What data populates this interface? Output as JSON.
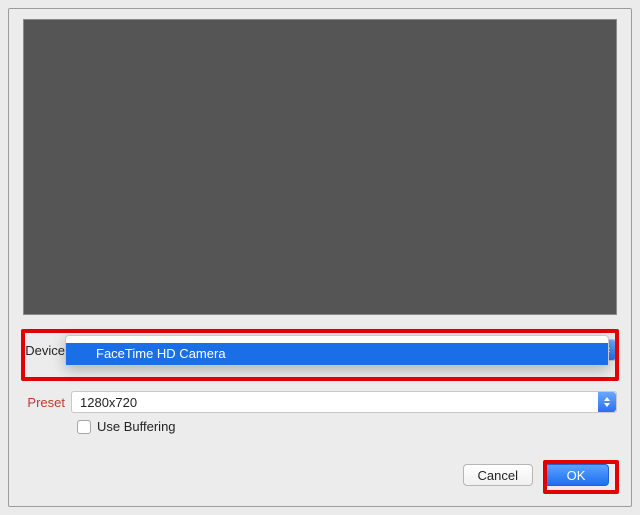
{
  "labels": {
    "device": "Device",
    "preset": "Preset",
    "useBuffering": "Use Buffering"
  },
  "device": {
    "selected_value": "",
    "options": [
      {
        "value": "",
        "checked": true,
        "highlighted": false
      },
      {
        "value": "FaceTime HD Camera",
        "checked": false,
        "highlighted": true
      }
    ]
  },
  "preset": {
    "value": "1280x720"
  },
  "buffering": {
    "checked": false
  },
  "buttons": {
    "cancel": "Cancel",
    "ok": "OK"
  },
  "colors": {
    "accent": "#1d6ff0",
    "highlight_border": "#e20000",
    "preview_bg": "#555555",
    "preset_label_color": "#c0392b"
  }
}
